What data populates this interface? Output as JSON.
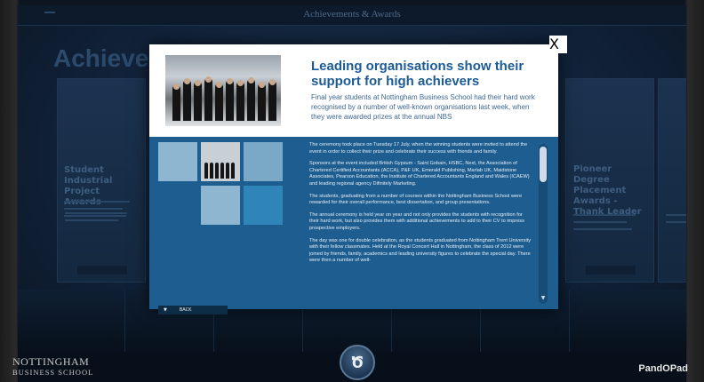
{
  "topbar": {
    "title": "Achievements & Awards"
  },
  "background": {
    "heading": "Achievements",
    "cards": [
      {
        "title": ""
      },
      {
        "title": "Student Industrial Project Awards"
      },
      {
        "title": ""
      },
      {
        "title": ""
      },
      {
        "title": "Pioneer Degree Placement Awards - Thank Leader"
      },
      {
        "title": ""
      }
    ]
  },
  "modal": {
    "close_label": "X",
    "title": "Leading organisations show their support for high achievers",
    "lead": "Final year students at Nottingham Business School had their hard work recognised by a number of well-known organisations last week, when they were awarded prizes at the annual NBS",
    "paragraphs": [
      "The ceremony took place on Tuesday 17 July, when the winning students were invited to attend the event in order to collect their prize and celebrate their success with friends and family.",
      "Sponsors at the event included British Gypsum - Saint Gobain, HSBC, Next, the Association of Chartered Certified Accountants (ACCA), P&F UK, Emerald Publishing, Marlab UK, Maidstone Associates, Pearson Education, the Institute of Chartered Accountants England and Wales (ICAEW) and leading regional agency Difinitely Marketing.",
      "The students, graduating from a number of courses within the Nottingham Business School were rewarded for their overall performance, best dissertation, and group presentations.",
      "The annual ceremony is held year on year and not only provides the students with recognition for their hard work, but also provides them with additional achievements to add to their CV to impress prospective employers.",
      "The day was one for double celebration, as the students graduated from Nottingham Trent University with their fellow classmates. Held at the Royal Concert Hall in Nottingham, the class of 2012 were joined by friends, family, academics and leading university figures to celebrate the special day. There were then a number of well-"
    ],
    "back_label": "BACK"
  },
  "footer": {
    "logo_line1": "NOTTINGHAM",
    "logo_line2": "BUSINESS SCHOOL",
    "home_symbol": "Ծ",
    "brand": "PandOPad"
  }
}
